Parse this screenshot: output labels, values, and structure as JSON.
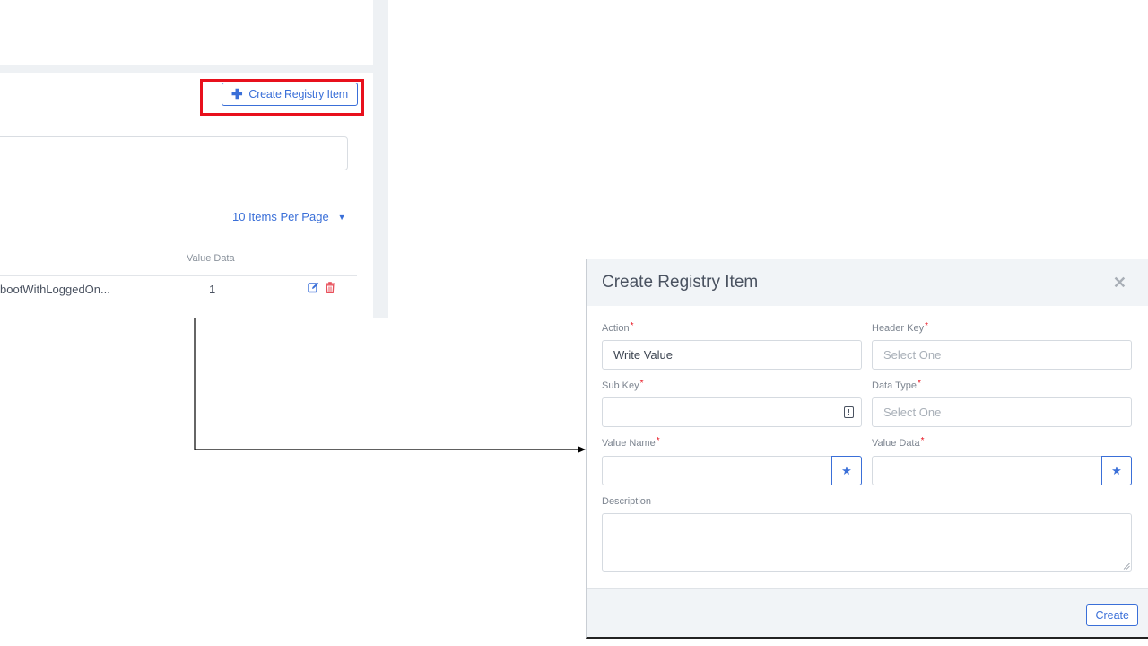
{
  "registry_panel": {
    "create_button_label": "Create Registry Item",
    "create_button_icon": "plus-icon",
    "items_per_page": "10 Items Per Page",
    "columns": {
      "value_data": "Value Data"
    },
    "rows": [
      {
        "name": "bootWithLoggedOn...",
        "value": "1"
      }
    ],
    "row_action_icons": [
      "edit-icon",
      "trash-icon"
    ]
  },
  "modal": {
    "title": "Create Registry Item",
    "close_icon": "close-icon",
    "fields": {
      "action": {
        "label": "Action",
        "value": "Write Value",
        "required": "*"
      },
      "header_key": {
        "label": "Header Key",
        "placeholder": "Select One",
        "required": "*"
      },
      "sub_key": {
        "label": "Sub Key",
        "value": "",
        "required": "*",
        "icon": "clipboard-icon"
      },
      "data_type": {
        "label": "Data Type",
        "placeholder": "Select One",
        "required": "*"
      },
      "value_name": {
        "label": "Value Name",
        "value": "",
        "required": "*",
        "icon": "star-icon"
      },
      "value_data": {
        "label": "Value Data",
        "value": "",
        "required": "*",
        "icon": "star-icon"
      },
      "description": {
        "label": "Description",
        "value": ""
      }
    },
    "submit_label": "Create"
  },
  "colors": {
    "accent": "#3a6fd8",
    "highlight": "#e8101c",
    "delete": "#e8505b",
    "header_bg": "#f1f4f7"
  }
}
